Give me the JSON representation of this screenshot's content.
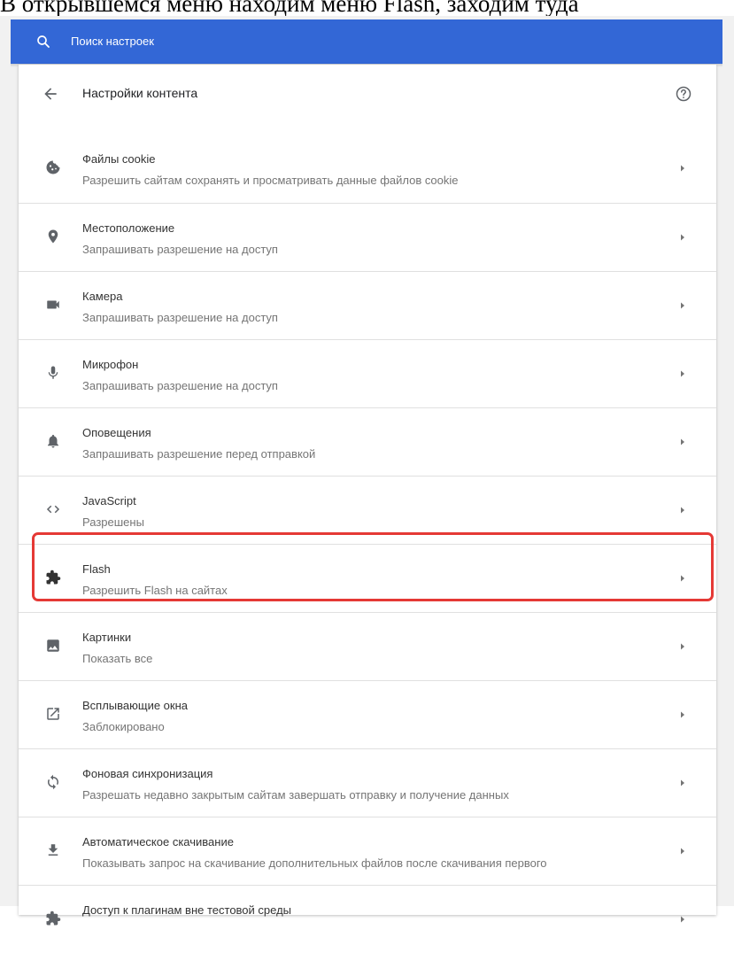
{
  "caption": "В открывшемся меню находим меню Flash, заходим туда",
  "search": {
    "placeholder": "Поиск настроек",
    "icon": "search-icon"
  },
  "header": {
    "title": "Настройки контента",
    "back_icon": "arrow-left-icon",
    "help_icon": "help-circle-icon"
  },
  "colors": {
    "search_bar": "#3367d6",
    "highlight": "#e53935",
    "icon": "#5f6368"
  },
  "items": [
    {
      "title": "Файлы cookie",
      "subtitle": "Разрешить сайтам сохранять и просматривать данные файлов cookie",
      "icon": "cookie-icon"
    },
    {
      "title": "Местоположение",
      "subtitle": "Запрашивать разрешение на доступ",
      "icon": "location-pin-icon"
    },
    {
      "title": "Камера",
      "subtitle": "Запрашивать разрешение на доступ",
      "icon": "camera-icon"
    },
    {
      "title": "Микрофон",
      "subtitle": "Запрашивать разрешение на доступ",
      "icon": "microphone-icon"
    },
    {
      "title": "Оповещения",
      "subtitle": "Запрашивать разрешение перед отправкой",
      "icon": "bell-icon"
    },
    {
      "title": "JavaScript",
      "subtitle": "Разрешены",
      "icon": "code-icon"
    },
    {
      "title": "Flash",
      "subtitle": "Разрешить Flash на сайтах",
      "icon": "puzzle-icon",
      "highlighted": true
    },
    {
      "title": "Картинки",
      "subtitle": "Показать все",
      "icon": "image-icon"
    },
    {
      "title": "Всплывающие окна",
      "subtitle": "Заблокировано",
      "icon": "open-in-new-icon"
    },
    {
      "title": "Фоновая синхронизация",
      "subtitle": "Разрешать недавно закрытым сайтам завершать отправку и получение данных",
      "icon": "sync-icon"
    },
    {
      "title": "Автоматическое скачивание",
      "subtitle": "Показывать запрос на скачивание дополнительных файлов после скачивания первого",
      "icon": "download-icon"
    },
    {
      "title": "Доступ к плагинам вне тестовой среды",
      "subtitle": "",
      "icon": "puzzle-icon"
    }
  ]
}
